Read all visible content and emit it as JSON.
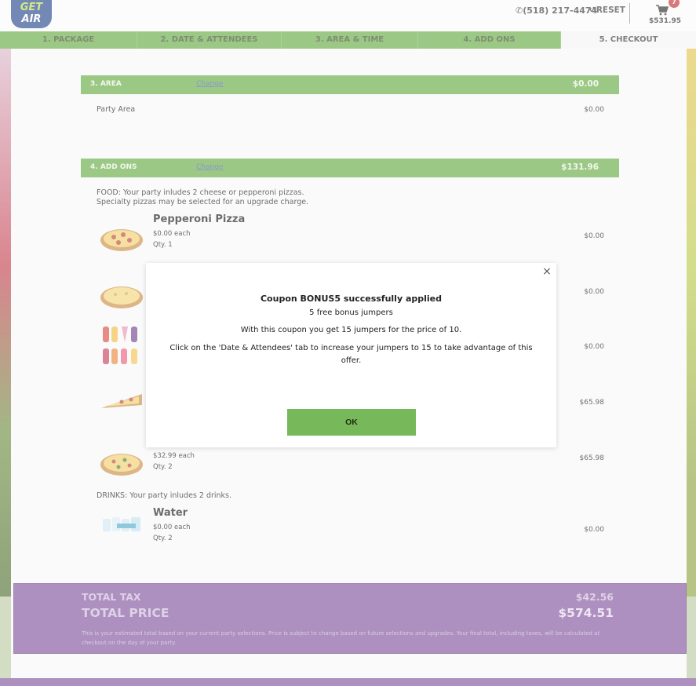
{
  "header": {
    "logo_top": "GET",
    "logo_bottom": "AIR",
    "phone": "(518) 217-4474",
    "reset_label": "RESET",
    "cart_count": "7",
    "cart_total": "$531.95"
  },
  "steps": [
    {
      "label": "1. PACKAGE"
    },
    {
      "label": "2. DATE & ATTENDEES"
    },
    {
      "label": "3. AREA & TIME"
    },
    {
      "label": "4. ADD ONS"
    },
    {
      "label": "5. CHECKOUT"
    }
  ],
  "area": {
    "title": "3. AREA",
    "change": "Change",
    "amount": "$0.00",
    "item_label": "Party Area",
    "item_amount": "$0.00"
  },
  "addons": {
    "title": "4. ADD ONS",
    "change": "Change",
    "amount": "$131.96",
    "food_note_1": "FOOD: Your party inludes 2 cheese or pepperoni pizzas.",
    "food_note_2": "Specialty pizzas may be selected for an upgrade charge.",
    "drinks_note": "DRINKS: Your party inludes 2 drinks.",
    "items": [
      {
        "name": "Pepperoni Pizza",
        "price": "$0.00 each",
        "qty": "Qty. 1",
        "amount": "$0.00"
      },
      {
        "amount": "$0.00"
      },
      {
        "amount": "$0.00"
      },
      {
        "amount": "$65.98"
      },
      {
        "price": "$32.99 each",
        "qty": "Qty. 2",
        "amount": "$65.98"
      },
      {
        "name": "Water",
        "price": "$0.00 each",
        "qty": "Qty. 2",
        "amount": "$0.00"
      }
    ]
  },
  "totals": {
    "tax_label": "TOTAL TAX",
    "tax_value": "$42.56",
    "price_label": "TOTAL PRICE",
    "price_value": "$574.51",
    "note": "This is your estimated total based on your current party selections. Price is subject to change based on future selections and upgrades. Your final total, including taxes, will be calculated at checkout on the day of your party."
  },
  "modal": {
    "title": "Coupon BONUS5 successfully applied",
    "subtitle": "5 free bonus jumpers",
    "line": "With this coupon you get 15 jumpers for the price of 10.",
    "paragraph": "Click on the 'Date & Attendees' tab to increase your jumpers to 15 to take advantage of this offer.",
    "ok_label": "OK",
    "close_glyph": "×"
  },
  "colors": {
    "brand_green": "#5fa63c",
    "brand_purple": "#7b4c98",
    "button_green": "#76b85a"
  },
  "icons": [
    "phone-icon",
    "reset-icon",
    "cart-icon",
    "close-icon"
  ]
}
